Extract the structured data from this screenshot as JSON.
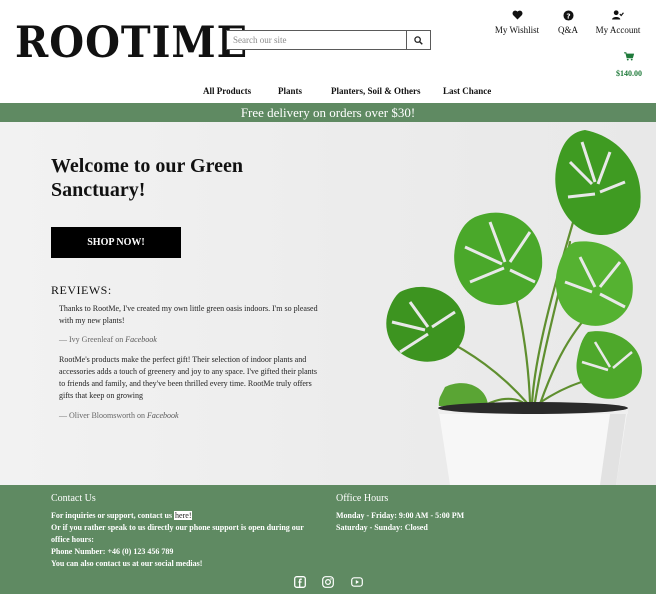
{
  "brand": {
    "logo_text": "ROOTIME"
  },
  "search": {
    "placeholder": "Search our site"
  },
  "header_nav": {
    "wishlist": "My Wishlist",
    "qa": "Q&A",
    "account": "My Account",
    "cart_total": "$140.00"
  },
  "main_nav": [
    "All Products",
    "Plants",
    "Planters, Soil & Others",
    "Last Chance"
  ],
  "banner": {
    "text": "Free delivery on orders over $30!"
  },
  "hero": {
    "title": "Welcome to our Green Sanctuary!",
    "cta": "SHOP NOW!",
    "reviews_title": "REVIEWS:",
    "reviews": [
      {
        "text": "Thanks to RootMe, I've created my own little green oasis indoors. I'm so pleased with my new plants!",
        "author": "— Ivy Greenleaf on ",
        "source": "Facebook"
      },
      {
        "text": "RootMe's products make the perfect gift! Their selection of indoor plants and accessories adds a touch of greenery and joy to any space. I've gifted their plants to friends and family, and they've been thrilled every time. RootMe truly offers gifts that keep on growing",
        "author": "— Oliver Bloomsworth on ",
        "source": "Facebook"
      }
    ]
  },
  "footer": {
    "contact_title": "Contact Us",
    "contact_line1_pre": "For inquiries or support, contact us ",
    "contact_line1_link": "here!",
    "contact_line2": "Or if you rather speak to us directly our phone support is open during our office hours:",
    "contact_phone": "Phone Number: +46 (0) 123 456 789",
    "contact_social": "You can also contact us at our social medias!",
    "office_title": "Office Hours",
    "office_weekdays": "Monday - Friday: 9:00 AM - 5:00 PM",
    "office_saturday": "Saturday - Sunday: Closed"
  },
  "icons": {
    "search": "search-icon",
    "wishlist": "heart-icon",
    "qa": "question-circle-icon",
    "account": "user-check-icon",
    "cart": "shopping-cart-icon",
    "social": [
      "facebook-icon",
      "instagram-icon",
      "youtube-icon"
    ]
  },
  "colors": {
    "accent_green": "#5f8a62",
    "cart_total": "#1f7a3a",
    "button_black": "#000000"
  }
}
